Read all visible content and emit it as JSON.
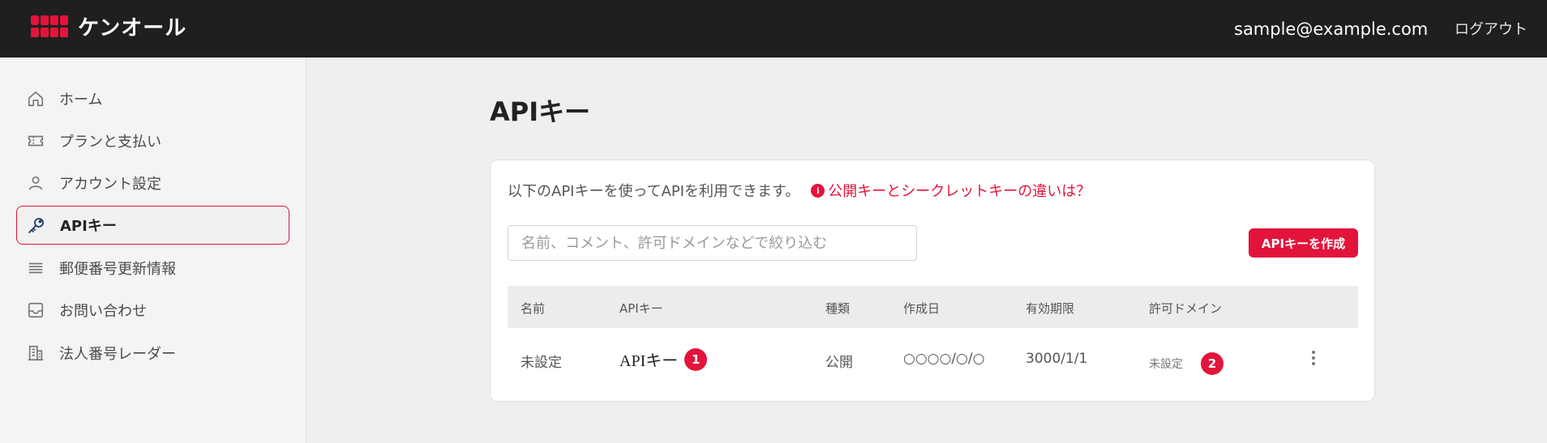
{
  "header": {
    "brand": "ケンオール",
    "user_email": "sample@example.com",
    "logout_label": "ログアウト"
  },
  "sidebar": {
    "items": [
      {
        "label": "ホーム",
        "icon": "home-icon"
      },
      {
        "label": "プランと支払い",
        "icon": "ticket-icon"
      },
      {
        "label": "アカウント設定",
        "icon": "user-icon"
      },
      {
        "label": "APIキー",
        "icon": "key-icon",
        "active": true
      },
      {
        "label": "郵便番号更新情報",
        "icon": "list-icon"
      },
      {
        "label": "お問い合わせ",
        "icon": "inbox-icon"
      },
      {
        "label": "法人番号レーダー",
        "icon": "building-icon"
      }
    ]
  },
  "main": {
    "title": "APIキー",
    "intro_text": "以下のAPIキーを使ってAPIを利用できます。",
    "info_icon_glyph": "i",
    "info_link": "公開キーとシークレットキーの違いは？",
    "search_placeholder": "名前、コメント、許可ドメインなどで絞り込む",
    "create_button": "APIキーを作成",
    "table": {
      "headers": [
        "名前",
        "APIキー",
        "種類",
        "作成日",
        "有効期限",
        "許可ドメイン"
      ],
      "rows": [
        {
          "name": "未設定",
          "api_key": "APIキー",
          "api_key_badge": "1",
          "type": "公開",
          "created": "○○○○/○/○",
          "expires": "3000/1/1",
          "domain": "未設定",
          "domain_badge": "2"
        }
      ]
    }
  },
  "colors": {
    "accent": "#e3143c",
    "header_bg": "#1f1f1f"
  }
}
